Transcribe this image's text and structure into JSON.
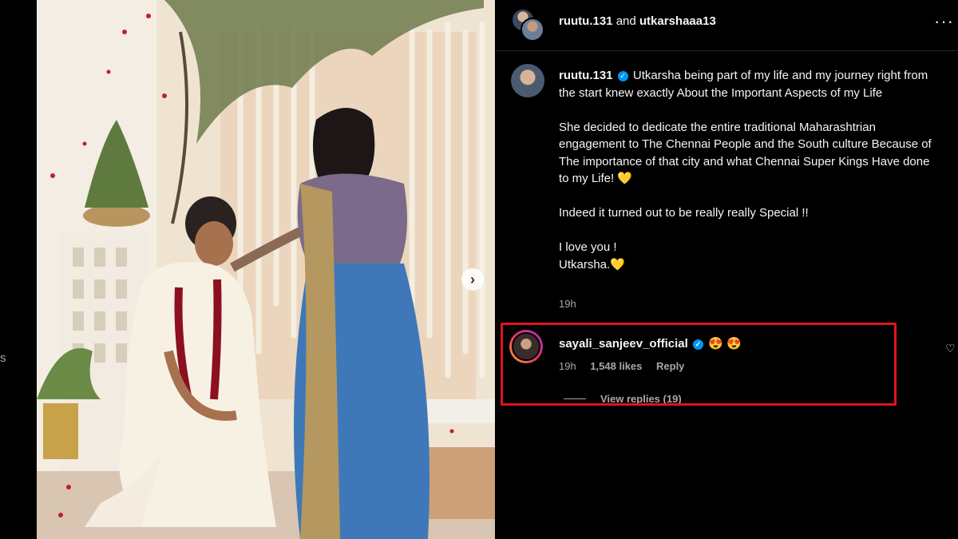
{
  "left_edge_text": "s",
  "header": {
    "user1": "ruutu.131",
    "conjunction": "and",
    "user2": "utkarshaaa13",
    "more_icon": "more-horizontal-icon"
  },
  "caption": {
    "username": "ruutu.131",
    "paragraphs": [
      "Utkarsha being part of my life and my journey right from the start knew exactly About the Important Aspects of my Life",
      "She decided to dedicate the entire traditional Maharashtrian engagement to The Chennai People and the South culture Because of The importance of that city and what Chennai Super Kings Have done to my Life! 💛",
      "Indeed it turned out to be really really Special !!",
      "I love you !",
      "Utkarsha.💛"
    ],
    "time": "19h"
  },
  "comment": {
    "username": "sayali_sanjeev_official",
    "text": "😍 😍",
    "time": "19h",
    "likes": "1,548 likes",
    "reply_label": "Reply",
    "view_replies": "View replies (19)",
    "highlight_color": "#e0141b"
  },
  "colors": {
    "background": "#000000",
    "text": "#f5f5f5",
    "secondary_text": "#a8a8a8",
    "verified": "#0095f6"
  }
}
